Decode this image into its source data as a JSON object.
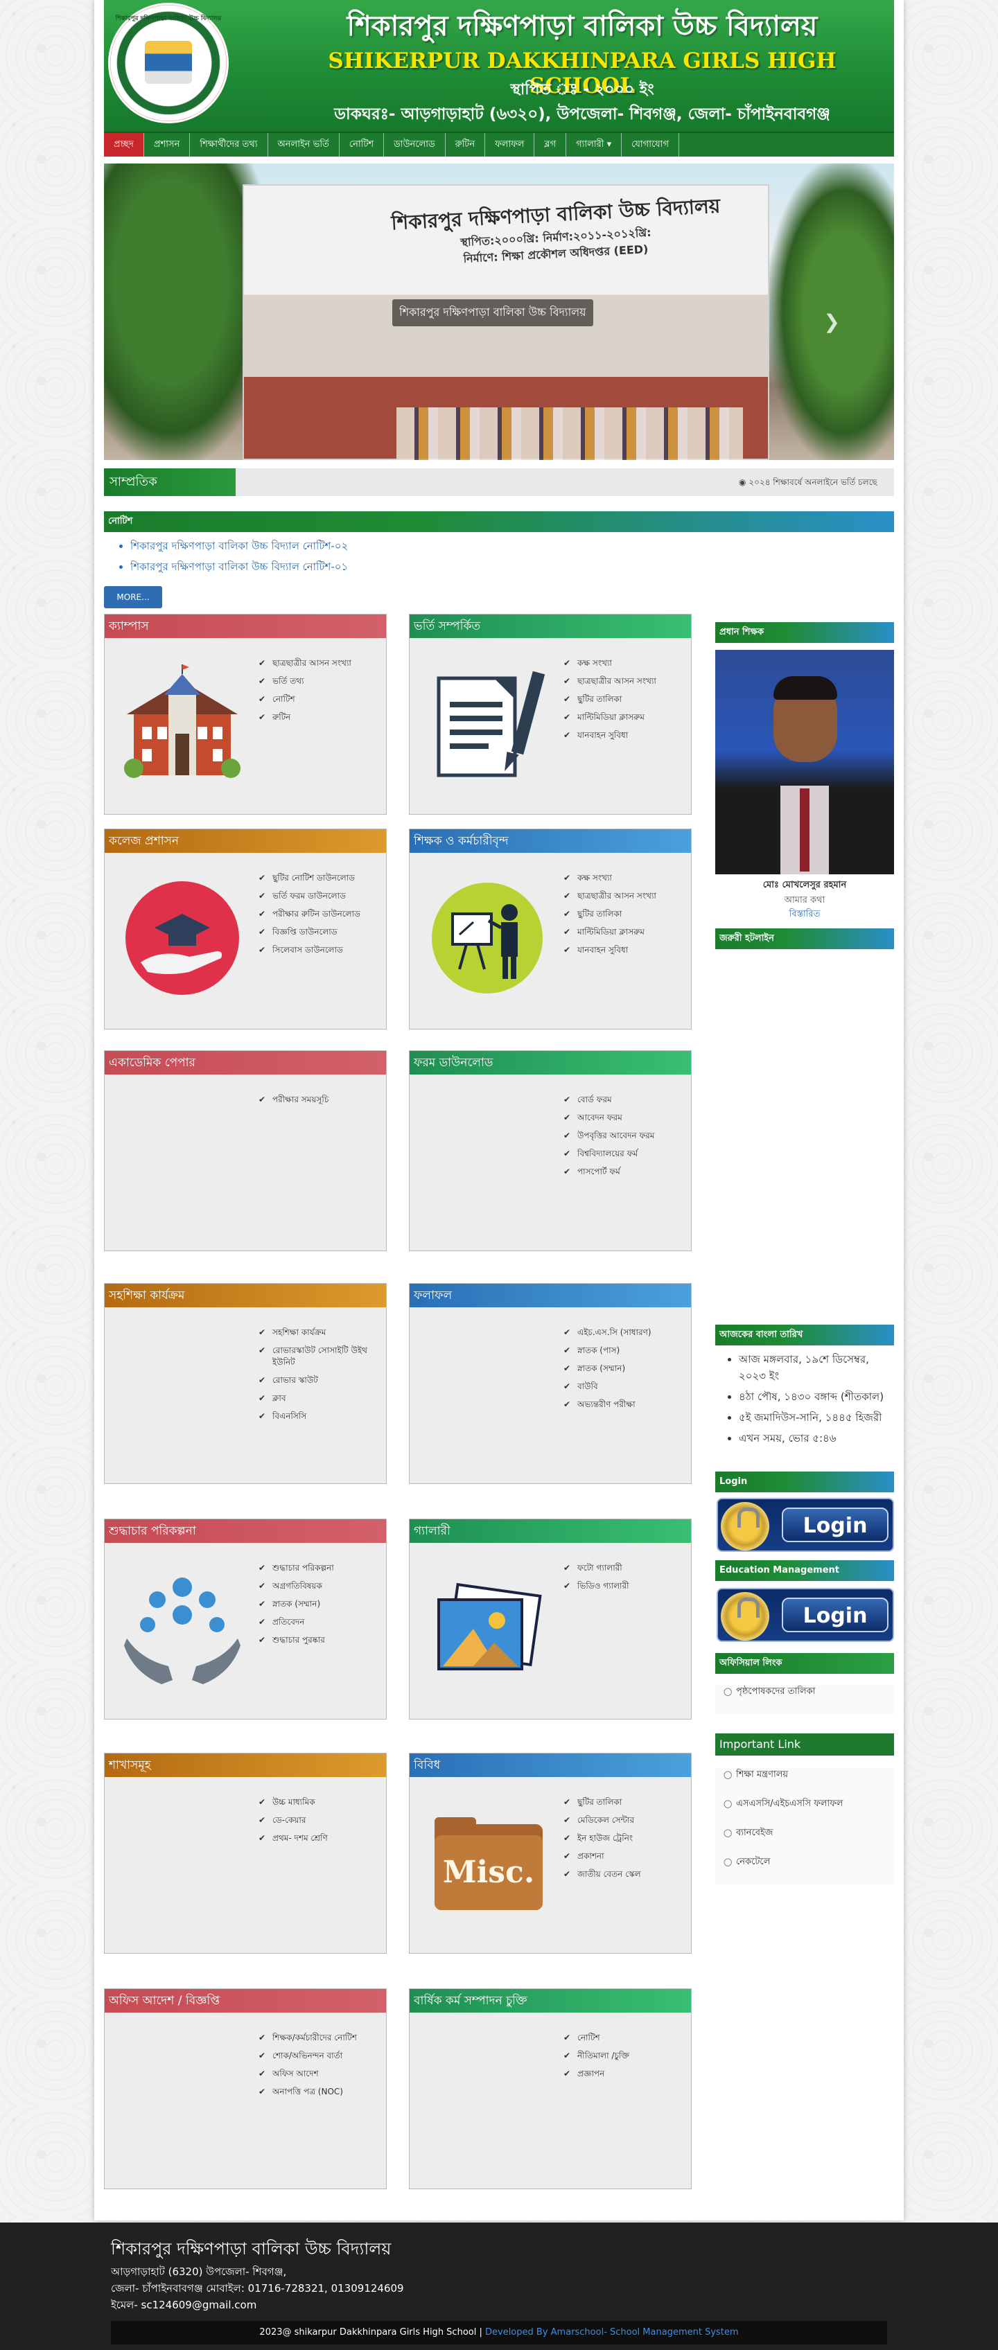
{
  "header": {
    "title_bn": "শিকারপুর দক্ষিণপাড়া বালিকা উচ্চ বিদ্যালয়",
    "title_en": "SHIKERPUR DAKKHINPARA GIRLS HIGH SCHOOL",
    "established": "স্থাপিত ঃ - ২০০০ ইং",
    "address": "ডাকঘরঃ- আড়গাড়াহাট (৬৩২০), উপজেলা- শিবগঞ্জ, জেলা- চাঁপাইনবাবগঞ্জ",
    "logo_text": "শিকারপুর দক্ষিণপাড়া বালিকা উচ্চ বিদ্যালয়"
  },
  "nav": [
    "প্রচ্ছদ",
    "প্রশাসন",
    "শিক্ষার্থীদের তথ্য",
    "অনলাইন ভর্তি",
    "নোটিশ",
    "ডাউনলোড",
    "রুটিন",
    "ফলাফল",
    "ব্লগ",
    "গ্যালারী ▾",
    "যোগাযোগ"
  ],
  "slider": {
    "caption": "শিকারপুর দক্ষিণপাড়া বালিকা উচ্চ বিদ্যালয়",
    "building_title": "শিকারপুর দক্ষিণপাড়া বালিকা উচ্চ বিদ্যালয়",
    "building_line1": "স্থাপিত:২০০০খ্রি: নির্মাণ:২০১১-২০১২খ্রি:",
    "building_line2": "নির্মাণে: শিক্ষা প্রকৌশল অধিদপ্তর (EED)"
  },
  "recent": {
    "label": "সাম্প্রতিক",
    "ticker": "২০২৪ শিক্ষাবর্ষে অনলাইনে ভর্তি চলছে"
  },
  "notice": {
    "heading": "নোটিশ",
    "items": [
      "শিকারপুর দক্ষিণপাড়া বালিকা উচ্চ বিদ্যাল নোটিশ-০২",
      "শিকারপুর দক্ষিণপাড়া বালিকা উচ্চ বিদ্যাল নোটিশ-০১"
    ],
    "more": "MORE..."
  },
  "cards": {
    "campus": {
      "title": "ক্যাম্পাস",
      "links": [
        "ছাত্রছাত্রীর আসন সংখ্যা",
        "ভর্তি তথ্য",
        "নোটিশ",
        "রুটিন"
      ]
    },
    "admission": {
      "title": "ভর্তি সম্পর্কিত",
      "links": [
        "কক্ষ সংখ্যা",
        "ছাত্রছাত্রীর আসন সংখ্যা",
        "ছুটির তালিকা",
        "মাল্টিমিডিয়া ক্লাসরুম",
        "যানবাহন সুবিধা"
      ]
    },
    "college_admin": {
      "title": "কলেজ প্রশাসন",
      "links": [
        "ছুটির নোটিশ ডাউনলোড",
        "ভর্তি ফরম ডাউনলোড",
        "পরীক্ষার রুটিন ডাউনলোড",
        "বিজ্ঞপ্তি ডাউনলোড",
        "সিলেবাস ডাউনলোড"
      ]
    },
    "teachers": {
      "title": "শিক্ষক ও কর্মচারীবৃন্দ",
      "links": [
        "কক্ষ সংখ্যা",
        "ছাত্রছাত্রীর আসন সংখ্যা",
        "ছুটির তালিকা",
        "মাল্টিমিডিয়া ক্লাসরুম",
        "যানবাহন সুবিধা"
      ]
    },
    "academic": {
      "title": "একাডেমিক পেপার",
      "links": [
        "পরীক্ষার সময়সূচি"
      ]
    },
    "forms": {
      "title": "ফরম ডাউনলোড",
      "links": [
        "বোর্ড ফরম",
        "আবেদন ফরম",
        "উপবৃত্তির আবেদন ফরম",
        "বিশ্ববিদ্যালয়ের ফর্ম",
        "পাসপোর্ট ফর্ম"
      ]
    },
    "cocurricular": {
      "title": "সহশিক্ষা কার্যক্রম",
      "links": [
        "সহশিক্ষা কার্যক্রম",
        "রোভারস্কাউট সোসাইটি উইথ ইউনিট",
        "রোভার স্কাউট",
        "ক্লাব",
        "বিএনসিসি"
      ]
    },
    "results": {
      "title": "ফলাফল",
      "links": [
        "এইচ.এস.সি (সাধারণ)",
        "স্নাতক (পাস)",
        "স্নাতক (সম্মান)",
        "বাউবি",
        "অভ্যন্তরীণ পরীক্ষা"
      ]
    },
    "integrity": {
      "title": "শুদ্ধাচার পরিকল্পনা",
      "links": [
        "শুদ্ধাচার পরিকল্পনা",
        "অগ্রগতিবিষয়ক",
        "স্নাতক (সম্মান)",
        "প্রতিবেদন",
        "শুদ্ধাচার পুরষ্কার"
      ]
    },
    "gallery": {
      "title": "গ্যালারী",
      "links": [
        "ফটো গ্যালারী",
        "ভিডিও গ্যালারী"
      ]
    },
    "branches": {
      "title": "শাখাসমূহ",
      "links": [
        "উচ্চ মাধ্যমিক",
        "ডে-কেয়ার",
        "প্রথম- দশম শ্রেণি"
      ]
    },
    "misc": {
      "title": "বিবিধ",
      "links": [
        "ছুটির তালিকা",
        "মেডিকেল সেন্টার",
        "ইন হাউজ ট্রেনিং",
        "প্রকাশনা",
        "জাতীয় বেতন স্কেল"
      ],
      "art_text": "Misc."
    },
    "office": {
      "title": "অফিস আদেশ / বিজ্ঞপ্তি",
      "links": [
        "শিক্ষক/কর্মচারীদের নোটিশ",
        "শোক/অভিনন্দন বার্তা",
        "অফিস আদেশ",
        "অনাপত্তি পত্র (NOC)"
      ]
    },
    "apa": {
      "title": "বার্ষিক কর্ম সম্পাদন চুক্তি",
      "links": [
        "নোটিশ",
        "নীতিমালা /চুক্তি",
        "প্রজ্ঞাপন"
      ]
    }
  },
  "sidebar": {
    "head_teacher": {
      "heading": "প্রধান শিক্ষক",
      "name": "মোঃ মোখলেসুর রহমান",
      "role": "আমার কথা",
      "link": "বিস্তারিত"
    },
    "hotline": {
      "heading": "জরুরী হটলাইন"
    },
    "date": {
      "heading": "আজকের বাংলা তারিখ",
      "items": [
        "আজ মঙ্গলবার, ১৯শে ডিসেম্বর, ২০২৩ ইং",
        "৪ঠা পৌষ, ১৪৩০ বঙ্গাব্দ (শীতকাল)",
        "৫ই জমাদিউস-সানি, ১৪৪৫ হিজরী",
        "এখন সময়, ভোর ৫:৪৬"
      ]
    },
    "login": {
      "heading": "Login",
      "button": "Login"
    },
    "edu": {
      "heading": "Education Management",
      "button": "Login"
    },
    "official": {
      "heading": "অফিসিয়াল লিংক",
      "items": [
        "পৃষ্ঠপোষকদের তালিকা"
      ]
    },
    "important": {
      "heading": "Important Link",
      "items": [
        "শিক্ষা মন্ত্রণালয়",
        "এসএসসি/এইচএসসি ফলাফল",
        "ব্যানবেইজ",
        "নেকটেলে"
      ]
    }
  },
  "footer": {
    "title": "শিকারপুর দক্ষিণপাড়া বালিকা উচ্চ বিদ্যালয়",
    "line1": "আড়গাড়াহাট (6320) উপজেলা- শিবগঞ্জ,",
    "line2": "জেলা- চাঁপাইনবাবগঞ্জ মোবাইল: 01716-728321, 01309124609",
    "line3": "ইমেল- sc124609@gmail.com",
    "copyright": "2023@ shikarpur Dakkhinpara Girls High School | ",
    "developer": "Developed By Amarschool- School Management System"
  },
  "colors": {
    "primary_green": "#1d7a2f",
    "active_red": "#c7262b",
    "link_blue": "#2a6cb3"
  }
}
